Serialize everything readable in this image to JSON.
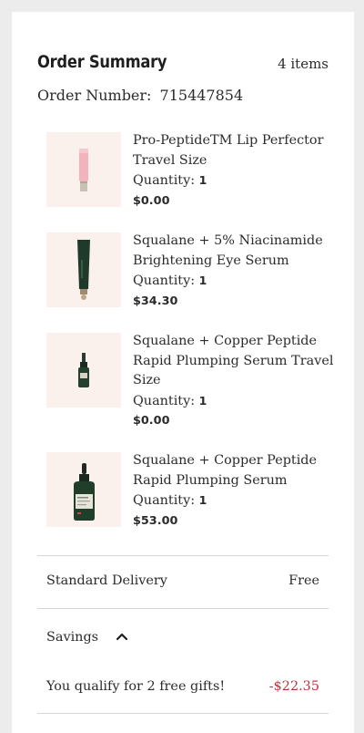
{
  "order_summary": {
    "title": "Order Summary",
    "item_count": "4 items",
    "order_number_label": "Order Number:",
    "order_number": "715447854"
  },
  "items": [
    {
      "name": "Pro-PeptideTM Lip Perfector Travel Size",
      "quantity_label": "Quantity:",
      "quantity": "1",
      "price": "$0.00",
      "image_icon": "lip-tube-icon"
    },
    {
      "name": "Squalane + 5% Niacinamide Brightening Eye Serum",
      "quantity_label": "Quantity:",
      "quantity": "1",
      "price": "$34.30",
      "image_icon": "eye-serum-tube-icon"
    },
    {
      "name": "Squalane + Copper Peptide Rapid Plumping Serum Travel Size",
      "quantity_label": "Quantity:",
      "quantity": "1",
      "price": "$0.00",
      "image_icon": "small-dropper-bottle-icon"
    },
    {
      "name": "Squalane + Copper Peptide Rapid Plumping Serum",
      "quantity_label": "Quantity:",
      "quantity": "1",
      "price": "$53.00",
      "image_icon": "dropper-bottle-icon"
    }
  ],
  "delivery": {
    "label": "Standard Delivery",
    "value": "Free"
  },
  "savings": {
    "label": "Savings",
    "expanded": true,
    "toggle_icon": "chevron-up-icon",
    "line_label": "You qualify for 2 free gifts!",
    "line_value": "-$22.35"
  },
  "colors": {
    "discount": "#b8323b",
    "thumb_bg": "#fbf1ec",
    "divider": "#d6d6d6"
  }
}
